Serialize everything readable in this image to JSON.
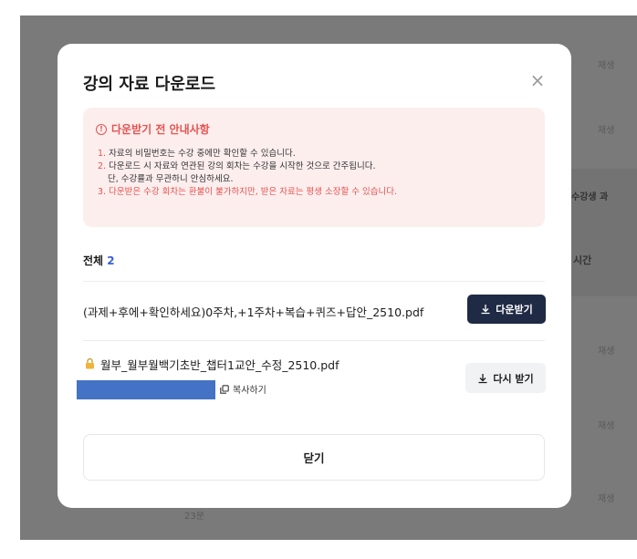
{
  "background": {
    "right_labels": [
      "재생",
      "재생",
      "수강생 과",
      "시간",
      "재생",
      "재생",
      "재생"
    ],
    "bottom_label": "23분"
  },
  "modal": {
    "title": "강의 자료 다운로드",
    "close_icon": "×",
    "notice": {
      "title": "다운받기 전 안내사항",
      "items": [
        {
          "num": "1.",
          "text": "자료의 비밀번호는 수강 중에만 확인할 수 있습니다."
        },
        {
          "num": "2.",
          "text": "다운로드 시 자료와 연관된 강의 회차는 수강을 시작한 것으로 간주됩니다.",
          "sub": "단, 수강률과 무관하니 안심하세요."
        },
        {
          "num": "3.",
          "text": "다운받은 수강 회차는 환불이 불가하지만, 받은 자료는 평생 소장할 수 있습니다."
        }
      ]
    },
    "total_label": "전체",
    "total_count": "2",
    "files": [
      {
        "name": "(과제+후에+확인하세요)0주차,+1주차+복습+퀴즈+답안_2510.pdf",
        "button": "다운받기"
      },
      {
        "name": "월부_월부월백기초반_챕터1교안_수정_2510.pdf",
        "button": "다시 받기",
        "copy_label": "복사하기"
      }
    ],
    "close_button": "닫기"
  },
  "colors": {
    "accent_red": "#e4534f",
    "accent_blue": "#3a5fd9",
    "primary_button": "#1f2a44",
    "redaction": "#4472c4"
  }
}
